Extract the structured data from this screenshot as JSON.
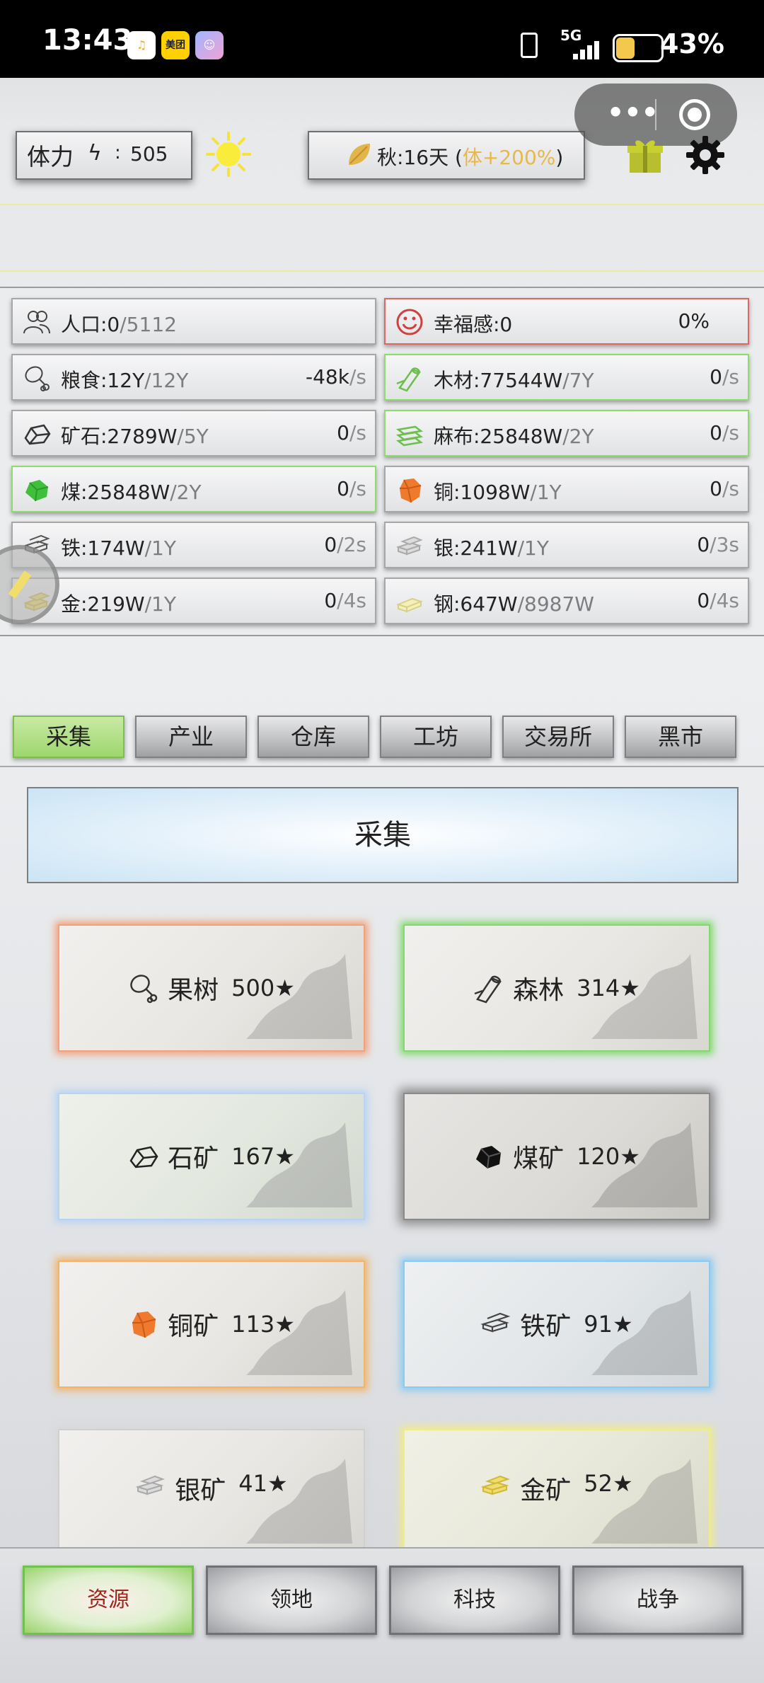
{
  "status_bar": {
    "time": "13:43",
    "apps": [
      {
        "name": "music-app-icon",
        "glyph": "♫",
        "color": "#f6a623"
      },
      {
        "name": "meituan-app-icon",
        "glyph": "美团",
        "color": "#ffd100"
      },
      {
        "name": "assistant-app-icon",
        "glyph": "☺",
        "color": "#8fa8ff"
      }
    ],
    "network": "5G",
    "battery": "43%"
  },
  "topbar": {
    "stamina_label": "体力",
    "stamina_colon": ":",
    "stamina_value": "505",
    "season_text": "秋:16天 (",
    "season_bonus": "体+200%",
    "season_close": ")"
  },
  "resources": [
    {
      "icon": "people-icon",
      "name": "人口:0",
      "cap": "/5112",
      "rate": "",
      "unit": "",
      "style": "normal"
    },
    {
      "icon": "smile-icon",
      "name": "幸福感:0",
      "cap": "",
      "rate": "0%",
      "unit": "",
      "style": "red"
    },
    {
      "icon": "meat-icon",
      "name": "粮食:12Y",
      "cap": "/12Y",
      "rate": "-48k",
      "unit": "/s",
      "style": "normal"
    },
    {
      "icon": "wood-icon",
      "name": "木材:77544W",
      "cap": "/7Y",
      "rate": "0",
      "unit": "/s",
      "style": "green"
    },
    {
      "icon": "stone-icon",
      "name": "矿石:2789W",
      "cap": "/5Y",
      "rate": "0",
      "unit": "/s",
      "style": "normal"
    },
    {
      "icon": "cloth-icon",
      "name": "麻布:25848W",
      "cap": "/2Y",
      "rate": "0",
      "unit": "/s",
      "style": "green"
    },
    {
      "icon": "coal-icon",
      "name": "煤:25848W",
      "cap": "/2Y",
      "rate": "0",
      "unit": "/s",
      "style": "green"
    },
    {
      "icon": "copper-icon",
      "name": "铜:1098W",
      "cap": "/1Y",
      "rate": "0",
      "unit": "/s",
      "style": "normal"
    },
    {
      "icon": "iron-icon",
      "name": "铁:174W",
      "cap": "/1Y",
      "rate": "0",
      "unit": "/2s",
      "style": "normal"
    },
    {
      "icon": "silver-icon",
      "name": "银:241W",
      "cap": "/1Y",
      "rate": "0",
      "unit": "/3s",
      "style": "normal"
    },
    {
      "icon": "gold-icon",
      "name": "金:219W",
      "cap": "/1Y",
      "rate": "0",
      "unit": "/4s",
      "style": "normal"
    },
    {
      "icon": "steel-icon",
      "name": "钢:647W",
      "cap": "/8987W",
      "rate": "0",
      "unit": "/4s",
      "style": "normal"
    }
  ],
  "tabs": [
    {
      "label": "采集",
      "active": true
    },
    {
      "label": "产业",
      "active": false
    },
    {
      "label": "仓库",
      "active": false
    },
    {
      "label": "工坊",
      "active": false
    },
    {
      "label": "交易所",
      "active": false
    },
    {
      "label": "黑市",
      "active": false
    }
  ],
  "section_title": "采集",
  "cards": [
    {
      "icon": "meat-icon",
      "name": "果树",
      "level": "500★",
      "glow": "orange"
    },
    {
      "icon": "wood-icon",
      "name": "森林",
      "level": "314★",
      "glow": "green"
    },
    {
      "icon": "stone-icon",
      "name": "石矿",
      "level": "167★",
      "glow": "blue"
    },
    {
      "icon": "coal-icon",
      "name": "煤矿",
      "level": "120★",
      "glow": "gray"
    },
    {
      "icon": "copper-icon",
      "name": "铜矿",
      "level": "113★",
      "glow": "amber"
    },
    {
      "icon": "iron-icon",
      "name": "铁矿",
      "level": "91★",
      "glow": "cyan"
    },
    {
      "icon": "silver-icon",
      "name": "银矿",
      "level": "41★",
      "glow": "light"
    },
    {
      "icon": "gold-icon",
      "name": "金矿",
      "level": "52★",
      "glow": "yellow"
    }
  ],
  "bottom_nav": [
    {
      "label": "资源",
      "active": true
    },
    {
      "label": "领地",
      "active": false
    },
    {
      "label": "科技",
      "active": false
    },
    {
      "label": "战争",
      "active": false
    }
  ]
}
